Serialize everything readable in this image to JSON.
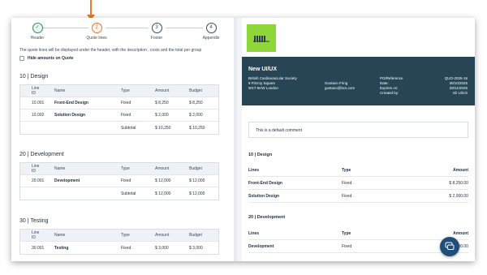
{
  "stepper": {
    "steps": [
      {
        "label": "Header",
        "num": "✓"
      },
      {
        "label": "Quote lines",
        "num": "2"
      },
      {
        "label": "Footer",
        "num": "3"
      },
      {
        "label": "Appendix",
        "num": "4"
      }
    ]
  },
  "hint": "The quote lines will be displayed under the header, with the description , costs and the total per group",
  "hide_amounts_label": "Hide amounts on Quote",
  "columns": {
    "id": "Line ID",
    "name": "Name",
    "type": "Type",
    "amount": "Amount",
    "budget": "Budget"
  },
  "groups": [
    {
      "title": "10 | Design",
      "rows": [
        {
          "id": "10.001",
          "name": "Front-End Design",
          "type": "Fixed",
          "amount": "$ 8,250",
          "budget": "$ 8,250"
        },
        {
          "id": "10.002",
          "name": "Solution Design",
          "type": "Fixed",
          "amount": "$ 2,000",
          "budget": "$ 2,000"
        }
      ],
      "subtotal": {
        "label": "Subtotal",
        "amount": "$ 10,250",
        "budget": "$ 10,250"
      }
    },
    {
      "title": "20 | Development",
      "rows": [
        {
          "id": "20.001",
          "name": "Development",
          "type": "Fixed",
          "amount": "$ 12,000",
          "budget": "$ 12,000"
        }
      ],
      "subtotal": {
        "label": "Subtotal",
        "amount": "$ 12,000",
        "budget": "$ 12,000"
      }
    },
    {
      "title": "30 | Testing",
      "rows": [
        {
          "id": "30.001",
          "name": "Testing",
          "type": "Fixed",
          "amount": "$ 3,000",
          "budget": "$ 3,000"
        }
      ]
    }
  ],
  "preview": {
    "logo_text": "KP CONSULTING",
    "title": "New UI/UX",
    "address": [
      "British Cardiovascular Society",
      "9 Fitzroy Square",
      "W1T 5HW London"
    ],
    "contact": [
      "Gustavo Fring",
      "gustavo@bcs.com"
    ],
    "meta_labels": [
      "PO/Reference",
      "Date:",
      "Expires on:",
      "Created by:"
    ],
    "meta_values": [
      "QUO-2025-16",
      "30/10/2025",
      "29/11/2025",
      "Eli Ulrich"
    ],
    "comment": "This is a default comment",
    "headers": {
      "lines": "Lines",
      "type": "Type",
      "amount": "Amount"
    },
    "groups": [
      {
        "title": "10 | Design",
        "rows": [
          {
            "name": "Front-End Design",
            "type": "Fixed",
            "amount": "$ 8,250.00"
          },
          {
            "name": "Solution Design",
            "type": "Fixed",
            "amount": "$ 2,000.00"
          }
        ]
      },
      {
        "title": "20 | Development",
        "rows": [
          {
            "name": "Development",
            "type": "Fixed",
            "amount": "$ 12,000.00"
          }
        ]
      }
    ]
  },
  "colors": {
    "accent": "#e8772e",
    "banner": "#274554",
    "logo": "#8fd63a",
    "chat": "#1f4e79"
  },
  "chat_icon": "chat-bubble-icon"
}
